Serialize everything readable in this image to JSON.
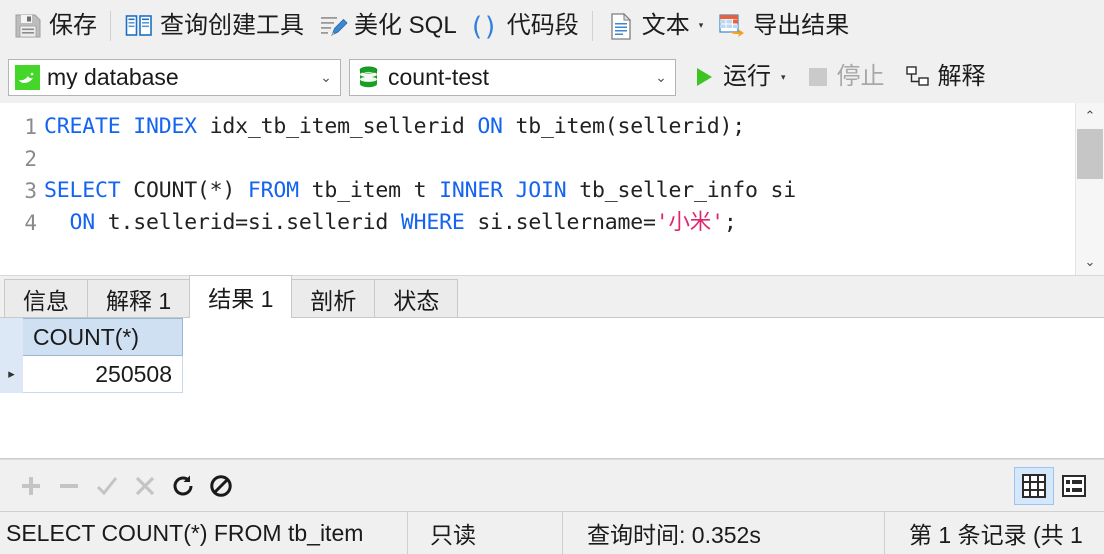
{
  "toolbar_top": {
    "items": [
      {
        "id": "save",
        "label": "保存",
        "icon": "floppy-disk-icon",
        "has_caret": false
      },
      {
        "id": "query_builder",
        "label": "查询创建工具",
        "icon": "query-builder-icon",
        "has_caret": false
      },
      {
        "id": "beautify_sql",
        "label": "美化 SQL",
        "icon": "beautify-sql-icon",
        "has_caret": false
      },
      {
        "id": "snippet",
        "label": "代码段",
        "icon": "code-snippet-icon",
        "has_caret": false
      },
      {
        "id": "text",
        "label": "文本",
        "icon": "text-document-icon",
        "has_caret": true
      },
      {
        "id": "export",
        "label": "导出结果",
        "icon": "export-result-icon",
        "has_caret": false
      }
    ]
  },
  "toolbar_second": {
    "connection": {
      "value": "my database",
      "icon": "mysql-dolphin-icon",
      "chevron": "chevron-down-icon"
    },
    "schema": {
      "value": "count-test",
      "icon": "database-cylinder-icon",
      "chevron": "chevron-down-icon"
    },
    "run": {
      "label": "运行",
      "icon": "play-triangle-icon",
      "has_caret": true,
      "enabled": true
    },
    "stop": {
      "label": "停止",
      "icon": "stop-square-icon",
      "enabled": false
    },
    "explain": {
      "label": "解释",
      "icon": "explain-plan-icon",
      "enabled": true
    }
  },
  "editor": {
    "line_numbers": [
      "1",
      "2",
      "3",
      "4"
    ],
    "lines": [
      [
        {
          "t": "CREATE INDEX",
          "c": "kw"
        },
        {
          "t": " idx_tb_item_sellerid ",
          "c": ""
        },
        {
          "t": "ON",
          "c": "kw"
        },
        {
          "t": " tb_item(sellerid);",
          "c": ""
        }
      ],
      [],
      [
        {
          "t": "SELECT",
          "c": "kw"
        },
        {
          "t": " COUNT(*) ",
          "c": ""
        },
        {
          "t": "FROM",
          "c": "kw"
        },
        {
          "t": " tb_item t ",
          "c": ""
        },
        {
          "t": "INNER JOIN",
          "c": "kw"
        },
        {
          "t": " tb_seller_info si",
          "c": ""
        }
      ],
      [
        {
          "t": "  ",
          "c": ""
        },
        {
          "t": "ON",
          "c": "kw"
        },
        {
          "t": " t.sellerid=si.sellerid ",
          "c": ""
        },
        {
          "t": "WHERE",
          "c": "kw"
        },
        {
          "t": " si.sellername=",
          "c": ""
        },
        {
          "t": "'小米'",
          "c": "str"
        },
        {
          "t": ";",
          "c": ""
        }
      ]
    ],
    "plain_text": "CREATE INDEX idx_tb_item_sellerid ON tb_item(sellerid);\n\nSELECT COUNT(*) FROM tb_item t INNER JOIN tb_seller_info si\n  ON t.sellerid=si.sellerid WHERE si.sellername='小米';",
    "scrollbar": {
      "up": "chevron-up-icon",
      "down": "chevron-down-icon"
    }
  },
  "tabs": [
    {
      "id": "info",
      "label": "信息",
      "active": false
    },
    {
      "id": "explain",
      "label": "解释 1",
      "active": false
    },
    {
      "id": "result",
      "label": "结果 1",
      "active": true
    },
    {
      "id": "profile",
      "label": "剖析",
      "active": false
    },
    {
      "id": "status",
      "label": "状态",
      "active": false
    }
  ],
  "result_grid": {
    "row_indicator": "current-row-arrow-icon",
    "columns": [
      "COUNT(*)"
    ],
    "rows": [
      {
        "marker": "▸",
        "values": [
          "250508"
        ]
      }
    ]
  },
  "grid_buttons": {
    "actions": [
      {
        "id": "add",
        "glyph": "+",
        "icon": "plus-icon",
        "enabled": false
      },
      {
        "id": "remove",
        "glyph": "−",
        "icon": "minus-icon",
        "enabled": false
      },
      {
        "id": "confirm",
        "glyph": "✓",
        "icon": "check-icon",
        "enabled": false
      },
      {
        "id": "cancel",
        "glyph": "✕",
        "icon": "cross-icon",
        "enabled": false
      },
      {
        "id": "refresh",
        "glyph": "↻",
        "icon": "refresh-icon",
        "enabled": true
      },
      {
        "id": "stop",
        "glyph": "⊘",
        "icon": "no-entry-icon",
        "enabled": true
      }
    ],
    "views": [
      {
        "id": "grid",
        "icon": "grid-view-icon",
        "selected": true
      },
      {
        "id": "form",
        "icon": "form-view-icon",
        "selected": false
      }
    ]
  },
  "status_bar": {
    "query": "SELECT COUNT(*) FROM tb_item",
    "readonly": "只读",
    "query_time": "查询时间: 0.352s",
    "record": "第 1 条记录 (共 1"
  },
  "colors": {
    "keyword": "#1464f0",
    "string": "#e0256e",
    "toolbar_bg": "#f0f0f0",
    "grid_header": "#cfe0f2",
    "selection": "#d5e7fa",
    "accent_green": "#2cb34a"
  }
}
